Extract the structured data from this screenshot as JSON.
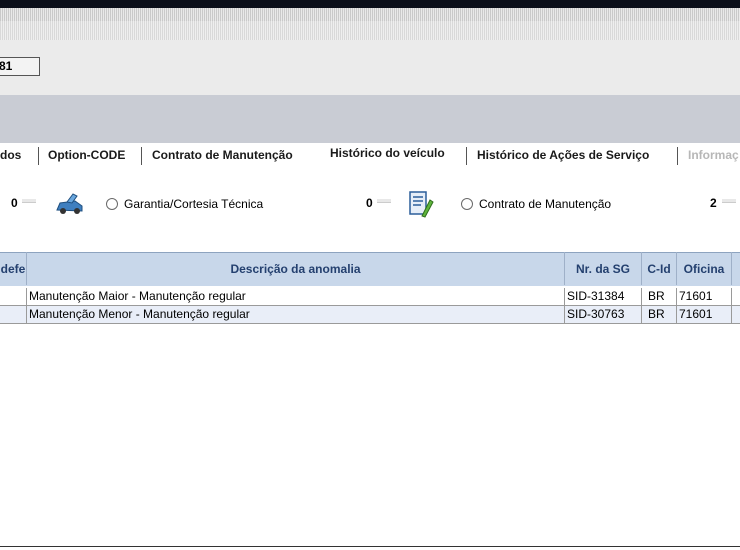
{
  "header": {
    "field_value": "81"
  },
  "tabs": [
    {
      "label": "dos",
      "state": "normal"
    },
    {
      "label": "Option-CODE",
      "state": "normal"
    },
    {
      "label": "Contrato de Manutenção",
      "state": "normal"
    },
    {
      "label": "Histórico do veículo",
      "state": "active"
    },
    {
      "label": "Histórico de Ações de Serviço",
      "state": "normal"
    },
    {
      "label": "Informaç",
      "state": "disabled"
    }
  ],
  "filters": {
    "first_count": "0",
    "garantia": {
      "label": "Garantia/Cortesia Técnica",
      "count": "0",
      "icon": "car-repair-icon"
    },
    "contrato": {
      "label": "Contrato de Manutenção",
      "count": "2",
      "icon": "maintenance-contract-icon"
    }
  },
  "table": {
    "columns": [
      "defe",
      "Descrição da anomalia",
      "Nr. da SG",
      "C-Id",
      "Oficina"
    ],
    "rows": [
      [
        "",
        "Manutenção Maior - Manutenção regular",
        "SID-31384",
        "BR",
        "71601"
      ],
      [
        "",
        "Manutenção Menor - Manutenção regular",
        "SID-30763",
        "BR",
        "71601"
      ]
    ]
  },
  "colors": {
    "header_bg": "#c8d7ea",
    "header_text": "#24406f",
    "alt_row": "#e9eef8"
  }
}
